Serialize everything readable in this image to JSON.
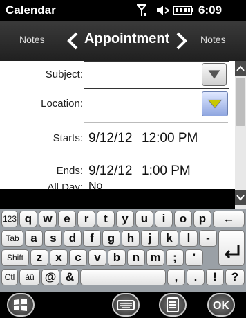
{
  "status": {
    "app_title": "Calendar",
    "clock": "6:09"
  },
  "nav": {
    "left": "Notes",
    "title": "Appointment",
    "right": "Notes"
  },
  "form": {
    "subject_label": "Subject:",
    "location_label": "Location:",
    "starts_label": "Starts:",
    "starts_date": "9/12/12",
    "starts_time": "12:00 PM",
    "ends_label": "Ends:",
    "ends_date": "9/12/12",
    "ends_time": "1:00 PM",
    "allday_label": "All Day:",
    "allday_value": "No"
  },
  "keyboard": {
    "row1": [
      "123",
      "q",
      "w",
      "e",
      "r",
      "t",
      "y",
      "u",
      "i",
      "o",
      "p",
      "←"
    ],
    "row2": [
      "Tab",
      "a",
      "s",
      "d",
      "f",
      "g",
      "h",
      "j",
      "k",
      "l",
      "-"
    ],
    "row3": [
      "Shift",
      "z",
      "x",
      "c",
      "v",
      "b",
      "n",
      "m",
      ";",
      "'"
    ],
    "row4": [
      "Ctl",
      "áü",
      "@",
      "&",
      "",
      ",",
      ".",
      "!",
      "?"
    ]
  },
  "softkeys": {
    "ok": "OK"
  },
  "colors": {
    "keyboard_bg": "#9aa0a6",
    "nav_bg": "#2a2a2a"
  }
}
